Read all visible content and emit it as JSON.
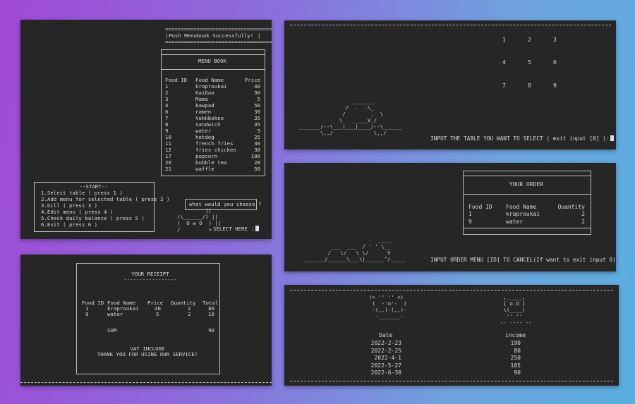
{
  "panel1": {
    "push_message": "Push Menubook Successfully!",
    "menu_title": "MENU BOOK",
    "columns": [
      "Food ID",
      "Food Name",
      "Price"
    ],
    "items": [
      {
        "id": "1",
        "name": "kraproukai",
        "price": "40"
      },
      {
        "id": "2",
        "name": "KaiDao",
        "price": "30"
      },
      {
        "id": "3",
        "name": "Mama",
        "price": "5"
      },
      {
        "id": "4",
        "name": "kawpad",
        "price": "50"
      },
      {
        "id": "6",
        "name": "ramen",
        "price": "30"
      },
      {
        "id": "7",
        "name": "tokkbokee",
        "price": "35"
      },
      {
        "id": "8",
        "name": "sandwich",
        "price": "35"
      },
      {
        "id": "9",
        "name": "water",
        "price": "5"
      },
      {
        "id": "10",
        "name": "hotdog",
        "price": "25"
      },
      {
        "id": "11",
        "name": "french fries",
        "price": "30"
      },
      {
        "id": "12",
        "name": "fries chicken",
        "price": "30"
      },
      {
        "id": "17",
        "name": "popcorn",
        "price": "100"
      },
      {
        "id": "20",
        "name": "bubble tea",
        "price": "20"
      },
      {
        "id": "21",
        "name": "waffle",
        "price": "50"
      }
    ],
    "start_title": "--START--",
    "start_options": [
      "1.Select table ( press 1 )",
      "2.Add menu for selected table ( press 2 )",
      "3.bill ( press 3 )",
      "4.Edit menu ( press 4 )",
      "5.Check daily balance ( press 5 )",
      "6.Exit ( press 6 )"
    ],
    "question": "what would you choose ?",
    "select_prompt": "SELECT HERE :"
  },
  "panel2": {
    "table_numbers": [
      "1",
      "2",
      "3",
      "4",
      "5",
      "6",
      "7",
      "8",
      "9"
    ],
    "prompt": "INPUT THE TABLE YOU WANT TO SELECT ( exit input [0] ):"
  },
  "panel3": {
    "title": "YOUR ORDER",
    "columns": [
      "Food ID",
      "Food Name",
      "Quantity"
    ],
    "items": [
      {
        "id": "1",
        "name": "kraproukai",
        "qty": "2"
      },
      {
        "id": "9",
        "name": "water",
        "qty": "2"
      }
    ],
    "prompt": "INPUT ORDER MENU [ID] TO CANCEL(If want to exit input 0) :"
  },
  "panel4": {
    "title": "YOUR RECEIPT",
    "columns": [
      "Food ID",
      "Food Name",
      "Price",
      "Quantity",
      "Total"
    ],
    "items": [
      {
        "id": "1",
        "name": "kraproukai",
        "price": "40",
        "qty": "2",
        "total": "80"
      },
      {
        "id": "9",
        "name": "water",
        "price": "5",
        "qty": "2",
        "total": "10"
      }
    ],
    "sum_label": "SUM",
    "sum_value": "90",
    "vat": "VAT INCLUDE",
    "thanks": "THANK YOU FOR USING OUR SERVICE!"
  },
  "panel5": {
    "columns": [
      "Date",
      "income"
    ],
    "rows": [
      {
        "date": "2022-2-23",
        "income": "190"
      },
      {
        "date": "2022-2-25",
        "income": "80"
      },
      {
        "date": "2022-4-1",
        "income": "250"
      },
      {
        "date": "2022-5-27",
        "income": "105"
      },
      {
        "date": "2022-6-30",
        "income": "90"
      }
    ]
  }
}
